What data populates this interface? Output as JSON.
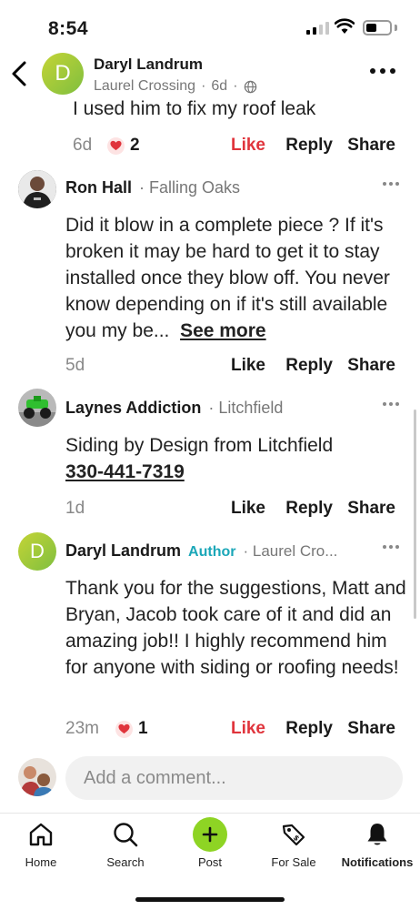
{
  "status": {
    "time": "8:54"
  },
  "header": {
    "avatar_letter": "D",
    "author_name": "Daryl Landrum",
    "neighborhood": "Laurel Crossing",
    "age": "6d"
  },
  "top_comment": {
    "text": "I used him to fix my roof leak",
    "time": "6d",
    "reaction_count": "2",
    "like_label": "Like",
    "reply_label": "Reply",
    "share_label": "Share"
  },
  "comments": [
    {
      "name": "Ron Hall",
      "neighborhood": "Falling Oaks",
      "text": "Did it blow in a complete piece ? If it's broken it may be hard to get it to stay installed once they blow off. You never know depending on if it's still available you my be...",
      "see_more": "See more",
      "time": "5d",
      "like_label": "Like",
      "reply_label": "Reply",
      "share_label": "Share"
    },
    {
      "name": "Laynes Addiction",
      "neighborhood": "Litchfield",
      "text": "Siding by Design from Litchfield",
      "phone": "330-441-7319",
      "time": "1d",
      "like_label": "Like",
      "reply_label": "Reply",
      "share_label": "Share"
    },
    {
      "avatar_letter": "D",
      "name": "Daryl Landrum",
      "author_tag": "Author",
      "neighborhood": "Laurel Cro...",
      "text": "Thank you for the suggestions, Matt and Bryan, Jacob took care of it and did an amazing job!! I highly recommend him for anyone with siding or roofing needs!",
      "time": "23m",
      "reaction_count": "1",
      "like_label": "Like",
      "reply_label": "Reply",
      "share_label": "Share"
    }
  ],
  "compose": {
    "placeholder": "Add a comment..."
  },
  "tabs": [
    {
      "label": "Home",
      "icon": "home-icon"
    },
    {
      "label": "Search",
      "icon": "search-icon"
    },
    {
      "label": "Post",
      "icon": "plus-icon"
    },
    {
      "label": "For Sale",
      "icon": "tag-icon"
    },
    {
      "label": "Notifications",
      "icon": "bell-icon"
    }
  ],
  "colors": {
    "like_red": "#e0343c",
    "author_teal": "#1ba7b8",
    "post_green": "#8ed424"
  }
}
